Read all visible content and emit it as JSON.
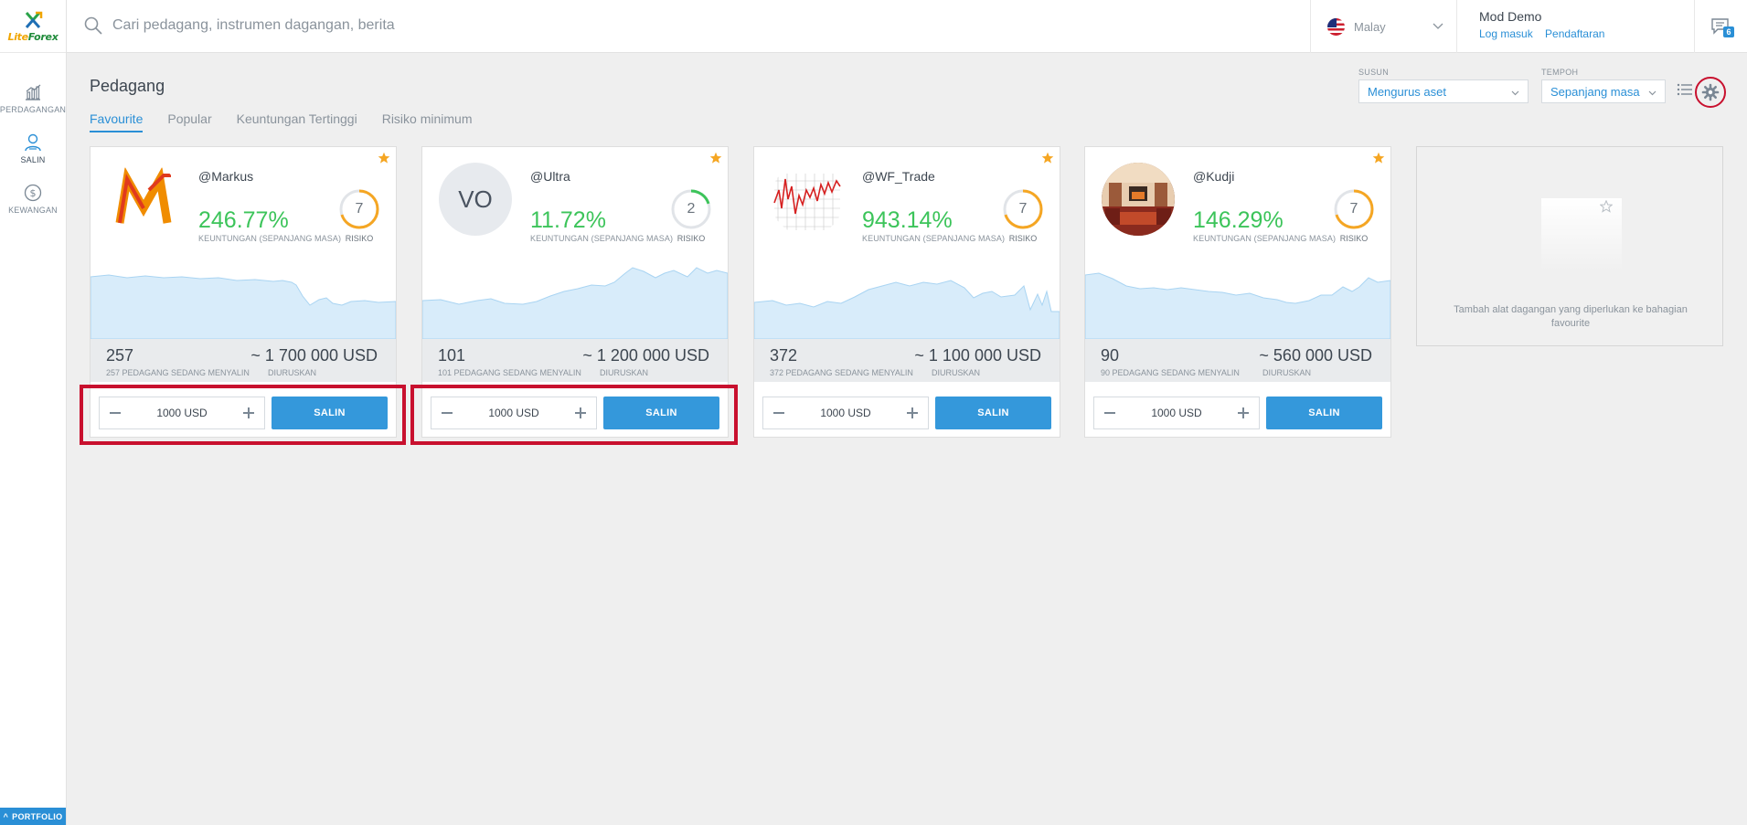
{
  "brand": {
    "logo_text_a": "Lite",
    "logo_text_b": "Forex"
  },
  "sidebar": {
    "items": [
      {
        "label": "PERDAGANGAN",
        "icon": "chart-icon"
      },
      {
        "label": "SALIN",
        "icon": "user-copy-icon"
      },
      {
        "label": "KEWANGAN",
        "icon": "dollar-icon"
      }
    ],
    "portfolio_label": "PORTFOLIO"
  },
  "header": {
    "search_placeholder": "Cari pedagang, instrumen dagangan, berita",
    "language": "Malay",
    "account_mode": "Mod Demo",
    "login_link": "Log masuk",
    "register_link": "Pendaftaran",
    "message_count": "6"
  },
  "page": {
    "title": "Pedagang",
    "tabs": [
      "Favourite",
      "Popular",
      "Keuntungan Tertinggi",
      "Risiko minimum"
    ],
    "active_tab": 0,
    "sort_label": "SUSUN",
    "sort_value": "Mengurus aset",
    "period_label": "TEMPOH",
    "period_value": "Sepanjang masa"
  },
  "labels": {
    "profit": "KEUNTUNGAN (SEPANJANG MASA)",
    "risk": "RISIKO",
    "managed": "DIURUSKAN",
    "copy_button": "SALIN"
  },
  "traders": [
    {
      "name": "@Markus",
      "profit": "246.77%",
      "risk": 7,
      "risk_level": 0.7,
      "copiers": "257",
      "copiers_label": "257 PEDAGANG SEDANG MENYALIN",
      "managed": "~ 1 700 000 USD",
      "amount": "1000 USD",
      "avatar": "markus-logo",
      "favourite": true
    },
    {
      "name": "@Ultra",
      "profit": "11.72%",
      "risk": 2,
      "risk_level": 0.2,
      "copiers": "101",
      "copiers_label": "101 PEDAGANG SEDANG MENYALIN",
      "managed": "~ 1 200 000 USD",
      "amount": "1000 USD",
      "avatar_initials": "VO",
      "favourite": true
    },
    {
      "name": "@WF_Trade",
      "profit": "943.14%",
      "risk": 7,
      "risk_level": 0.7,
      "copiers": "372",
      "copiers_label": "372 PEDAGANG SEDANG MENYALIN",
      "managed": "~ 1 100 000 USD",
      "amount": "1000 USD",
      "avatar": "wf-chart",
      "favourite": true
    },
    {
      "name": "@Kudji",
      "profit": "146.29%",
      "risk": 7,
      "risk_level": 0.7,
      "copiers": "90",
      "copiers_label": "90 PEDAGANG SEDANG MENYALIN",
      "managed": "~ 560 000 USD",
      "amount": "1000 USD",
      "avatar": "room-photo",
      "favourite": true
    }
  ],
  "add_favourite_text": "Tambah alat dagangan yang diperlukan ke bahagian favourite",
  "colors": {
    "accent": "#2a8fd6",
    "button": "#3498db",
    "profit": "#3cc45a",
    "risk_high": "#f5a623",
    "risk_low": "#3cc45a",
    "highlight": "#c8102e",
    "sparkline_fill": "#d8ecfa",
    "sparkline_stroke": "#a9d4f2"
  }
}
